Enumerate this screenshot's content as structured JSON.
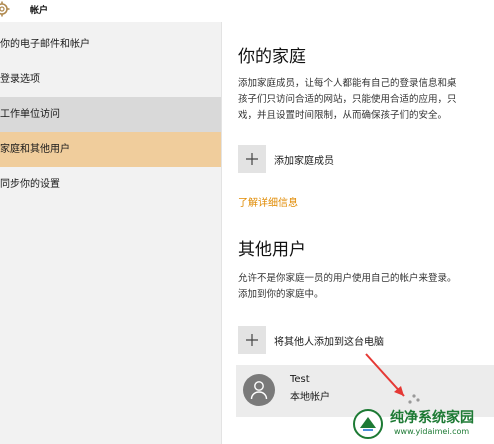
{
  "window": {
    "title": "帐户",
    "icon": "gear-icon"
  },
  "sidebar": {
    "items": [
      {
        "label": "你的电子邮件和帐户"
      },
      {
        "label": "登录选项"
      },
      {
        "label": "工作单位访问"
      },
      {
        "label": "家庭和其他用户"
      },
      {
        "label": "同步你的设置"
      }
    ],
    "selected_index": 3,
    "hover_index": 2
  },
  "family": {
    "heading": "你的家庭",
    "description_lines": [
      "添加家庭成员，让每个人都能有自己的登录信息和桌",
      "孩子们只访问合适的网站，只能使用合适的应用，只",
      "戏，并且设置时间限制，从而确保孩子们的安全。"
    ],
    "add_label": "添加家庭成员",
    "learn_more": "了解详细信息"
  },
  "others": {
    "heading": "其他用户",
    "description_lines": [
      "允许不是你家庭一员的用户使用自己的帐户来登录。",
      "添加到你的家庭中。"
    ],
    "add_label": "将其他人添加到这台电脑",
    "user": {
      "name": "Test",
      "type": "本地帐户"
    }
  },
  "watermark": {
    "title": "纯净系统家园",
    "url": "www.yidaimei.com"
  },
  "colors": {
    "accent": "#e08a00",
    "selected": "#f0cd9c",
    "hover": "#d9d9d9",
    "sidebar": "#f2f2f2",
    "annotation": "#e53935"
  }
}
